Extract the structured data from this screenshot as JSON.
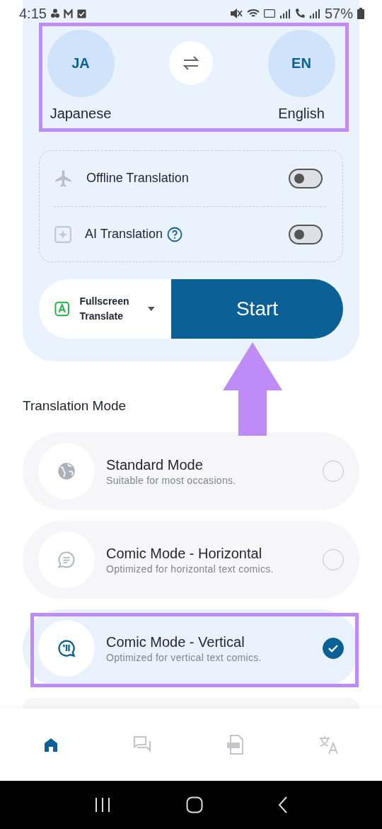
{
  "status_bar": {
    "time": "4:15",
    "battery": "57%"
  },
  "languages": {
    "source": {
      "code": "JA",
      "name": "Japanese"
    },
    "target": {
      "code": "EN",
      "name": "English"
    }
  },
  "options": [
    {
      "kind": "offline",
      "label": "Offline Translation",
      "on": false,
      "help": false
    },
    {
      "kind": "ai",
      "label": "AI Translation",
      "on": false,
      "help": true
    }
  ],
  "mode_picker": {
    "label": "Fullscreen Translate"
  },
  "start_button": "Start",
  "section_title": "Translation Mode",
  "modes": [
    {
      "kind": "standard",
      "title": "Standard Mode",
      "subtitle": "Suitable for most occasions.",
      "selected": false
    },
    {
      "kind": "horizontal",
      "title": "Comic Mode - Horizontal",
      "subtitle": "Optimized for horizontal text comics.",
      "selected": false
    },
    {
      "kind": "vertical",
      "title": "Comic Mode - Vertical",
      "subtitle": "Optimized for vertical text comics.",
      "selected": true
    }
  ],
  "nav": [
    {
      "kind": "home",
      "selected": true
    },
    {
      "kind": "chat",
      "selected": false
    },
    {
      "kind": "pdf",
      "selected": false
    },
    {
      "kind": "translate",
      "selected": false
    }
  ]
}
